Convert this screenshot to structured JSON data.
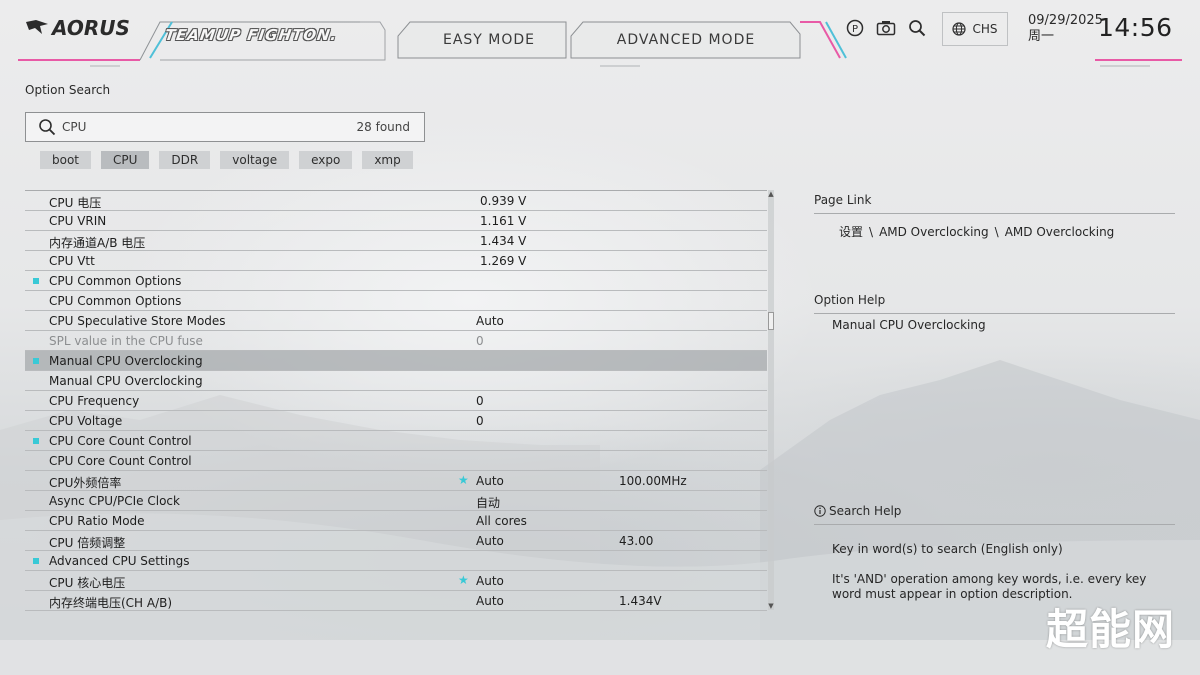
{
  "header": {
    "brand": "AORUS",
    "team_logo": "TEAMUP FIGHTON.",
    "easy_mode": "EASY MODE",
    "advanced_mode": "ADVANCED MODE",
    "icons": [
      "help-icon",
      "camera-icon",
      "search-icon",
      "globe-icon"
    ],
    "language": "CHS",
    "date": "09/29/2025",
    "weekday": "周一",
    "time": "14:56"
  },
  "search": {
    "label": "Option Search",
    "query": "CPU",
    "result_count": "28 found",
    "chips": [
      {
        "label": "boot",
        "active": false
      },
      {
        "label": "CPU",
        "active": true
      },
      {
        "label": "DDR",
        "active": false
      },
      {
        "label": "voltage",
        "active": false
      },
      {
        "label": "expo",
        "active": false
      },
      {
        "label": "xmp",
        "active": false
      }
    ]
  },
  "options": [
    {
      "name": "CPU 电压",
      "value": "0.939 V",
      "value2": "",
      "dot": false,
      "star": false,
      "dim": false,
      "selected": false
    },
    {
      "name": "CPU VRIN",
      "value": "1.161 V",
      "value2": "",
      "dot": false,
      "star": false,
      "dim": false,
      "selected": false
    },
    {
      "name": "内存通道A/B 电压",
      "value": "1.434 V",
      "value2": "",
      "dot": false,
      "star": false,
      "dim": false,
      "selected": false
    },
    {
      "name": "CPU Vtt",
      "value": "1.269 V",
      "value2": "",
      "dot": false,
      "star": false,
      "dim": false,
      "selected": false
    },
    {
      "name": "CPU Common Options",
      "value": "",
      "value2": "",
      "dot": true,
      "star": false,
      "dim": false,
      "selected": false
    },
    {
      "name": "CPU Common Options",
      "value": "",
      "value2": "",
      "dot": false,
      "star": false,
      "dim": false,
      "selected": false
    },
    {
      "name": "CPU Speculative Store Modes",
      "value": "Auto",
      "value2": "",
      "dot": false,
      "star": false,
      "dim": false,
      "selected": false
    },
    {
      "name": "SPL value in the CPU fuse",
      "value": "0",
      "value2": "",
      "dot": false,
      "star": false,
      "dim": true,
      "selected": false
    },
    {
      "name": "Manual CPU Overclocking",
      "value": "",
      "value2": "",
      "dot": true,
      "star": false,
      "dim": false,
      "selected": true
    },
    {
      "name": "Manual CPU Overclocking",
      "value": "",
      "value2": "",
      "dot": false,
      "star": false,
      "dim": false,
      "selected": false
    },
    {
      "name": "CPU Frequency",
      "value": "0",
      "value2": "",
      "dot": false,
      "star": false,
      "dim": false,
      "selected": false
    },
    {
      "name": "CPU Voltage",
      "value": "0",
      "value2": "",
      "dot": false,
      "star": false,
      "dim": false,
      "selected": false
    },
    {
      "name": "CPU Core Count Control",
      "value": "",
      "value2": "",
      "dot": true,
      "star": false,
      "dim": false,
      "selected": false
    },
    {
      "name": "CPU Core Count Control",
      "value": "",
      "value2": "",
      "dot": false,
      "star": false,
      "dim": false,
      "selected": false
    },
    {
      "name": "CPU外频倍率",
      "value": "Auto",
      "value2": "100.00MHz",
      "dot": false,
      "star": true,
      "dim": false,
      "selected": false
    },
    {
      "name": "Async CPU/PCIe Clock",
      "value": "自动",
      "value2": "",
      "dot": false,
      "star": false,
      "dim": false,
      "selected": false
    },
    {
      "name": "CPU Ratio Mode",
      "value": "All cores",
      "value2": "",
      "dot": false,
      "star": false,
      "dim": false,
      "selected": false
    },
    {
      "name": "CPU 倍频调整",
      "value": "Auto",
      "value2": "43.00",
      "dot": false,
      "star": false,
      "dim": false,
      "selected": false
    },
    {
      "name": "Advanced CPU Settings",
      "value": "",
      "value2": "",
      "dot": true,
      "star": false,
      "dim": false,
      "selected": false
    },
    {
      "name": "CPU 核心电压",
      "value": "Auto",
      "value2": "",
      "dot": false,
      "star": true,
      "dim": false,
      "selected": false
    },
    {
      "name": "内存终端电压(CH A/B)",
      "value": "Auto",
      "value2": "1.434V",
      "dot": false,
      "star": false,
      "dim": false,
      "selected": false
    }
  ],
  "page_link": {
    "title": "Page Link",
    "path": [
      "设置",
      "AMD Overclocking",
      "AMD Overclocking"
    ],
    "separator": "\\"
  },
  "option_help": {
    "title": "Option Help",
    "text": "Manual CPU Overclocking"
  },
  "search_help": {
    "title": "Search Help",
    "line1": "Key in word(s) to search (English only)",
    "line2": "It's 'AND' operation among key words, i.e. every key word must appear in option description."
  },
  "watermark": "超能网",
  "colors": {
    "accent_cyan": "#39c9d6",
    "accent_pink": "#e85aa6",
    "selected_row": "#a6a9ac"
  }
}
